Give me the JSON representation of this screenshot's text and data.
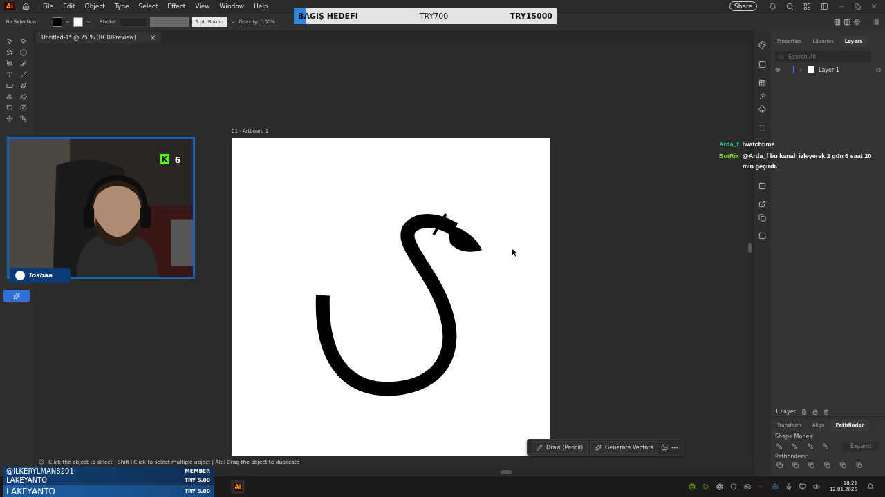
{
  "menu_bar": {
    "app_logo": "Ai",
    "menus": [
      "File",
      "Edit",
      "Object",
      "Type",
      "Select",
      "Effect",
      "View",
      "Window",
      "Help"
    ],
    "share_button": "Share"
  },
  "control_bar": {
    "selection": "No Selection",
    "stroke_label": "Stroke:",
    "brush": "3 pt. Round",
    "opacity_label": "Opacity:",
    "opacity": "100%"
  },
  "document_tab": {
    "title": "Untitled-1* @ 25 % (RGB/Preview)",
    "close": "×"
  },
  "artboard": {
    "label": "01 - Artboard 1"
  },
  "contextual_bar": {
    "buttons": [
      {
        "kind": "pencil",
        "label": "Draw (Pencil)"
      },
      {
        "kind": "vectors",
        "label": "Generate Vectors"
      }
    ]
  },
  "status_bar": {
    "hint": "Click the object to select | Shift+Click to select multiple object | Alt+Drag the object to duplicate"
  },
  "right_panel": {
    "tabs": [
      {
        "label": "Properties",
        "selected": false
      },
      {
        "label": "Libraries",
        "selected": false
      },
      {
        "label": "Layers",
        "selected": true
      }
    ],
    "search": {
      "placeholder": "Search All"
    },
    "layers": [
      {
        "name": "Layer 1",
        "color": "#4a6cf7"
      }
    ],
    "layer_count": "1 Layer",
    "lower_tabs": [
      {
        "label": "Transform",
        "selected": false
      },
      {
        "label": "Align",
        "selected": false
      },
      {
        "label": "Pathfinder",
        "selected": true
      }
    ],
    "shape_modes_label": "Shape Modes:",
    "expand_button": {
      "label": "Expand",
      "disabled": true
    },
    "pathfinders_label": "Pathfinders:"
  },
  "taskbar": {
    "pinned_app": "Ai",
    "time": "18:21",
    "date": "12.01.2026"
  },
  "stream_overlay": {
    "donation_goal": {
      "title": "BAĞIŞ HEDEFİ",
      "current": "TRY700",
      "target": "TRY15000",
      "level": 0.047
    },
    "webcam": {
      "kind": "picture",
      "badge_logo": "K",
      "badge_count": "6",
      "channel": "Tosbaa"
    },
    "chat": [
      {
        "user": "Arda_f",
        "color": "#2fd38f",
        "message": "!watchtime"
      },
      {
        "user": "BotRix",
        "color": "#7bdc2e",
        "message": "@Arda_f bu kanalı izleyerek 2 gün 6 saat 20 min geçirdi."
      }
    ],
    "alerts": [
      {
        "name": "@ILKERYLMAN8291",
        "detail": "MEMBER",
        "highlighted": false
      },
      {
        "name": "LAKEYANTO",
        "detail": "TRY 5.00",
        "highlighted": false
      },
      {
        "name": "LAKEYANTO",
        "detail": "TRY 5.00",
        "highlighted": true
      }
    ]
  }
}
